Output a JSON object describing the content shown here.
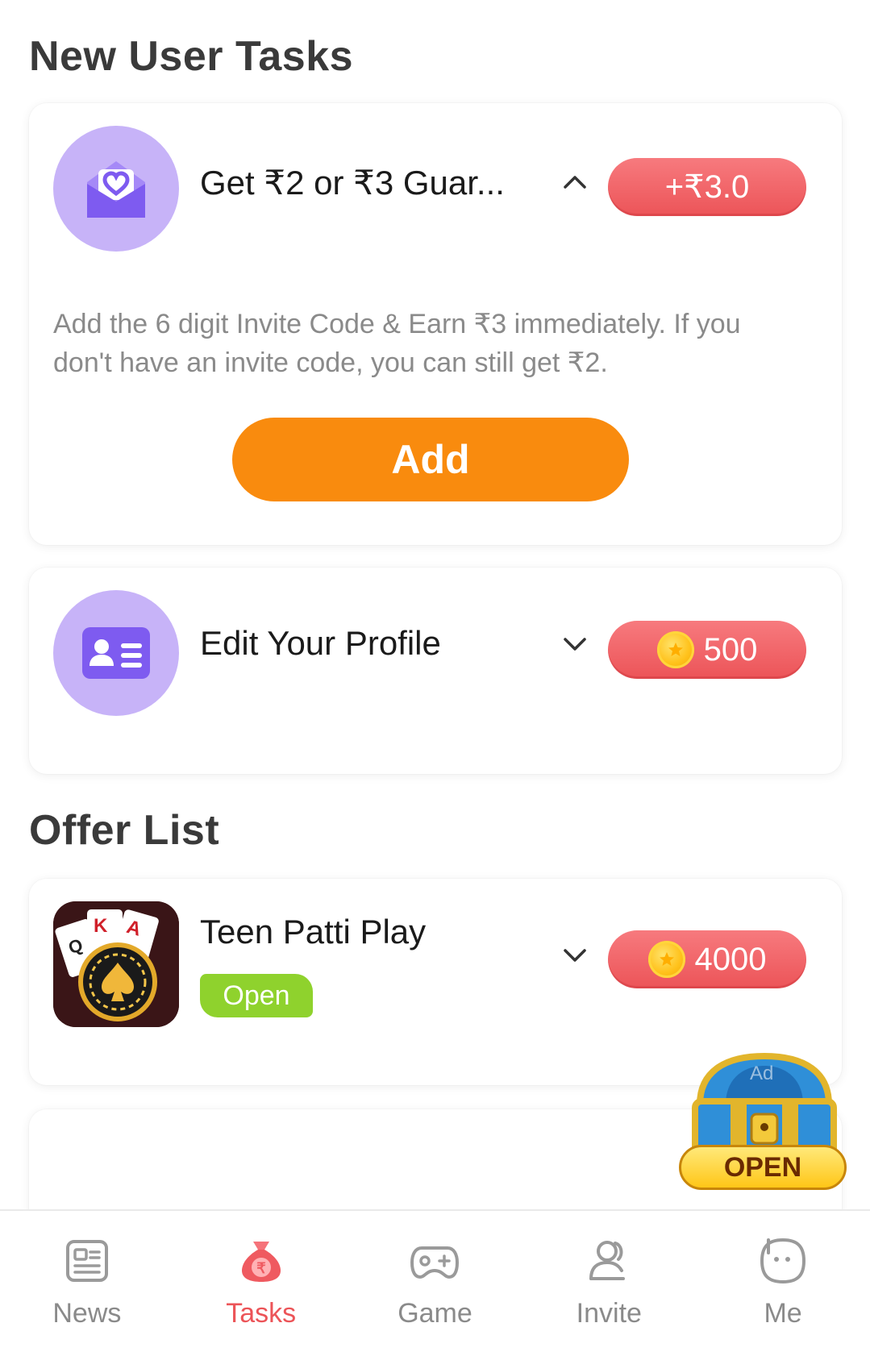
{
  "sections": {
    "new_user_title": "New User Tasks",
    "offer_title": "Offer List"
  },
  "tasks": [
    {
      "title": "Get ₹2 or ₹3 Guar...",
      "reward": "+₹3.0",
      "description": "Add the 6 digit Invite Code & Earn ₹3 immediately. If you don't have an invite code, you can still get ₹2.",
      "button_label": "Add",
      "icon": "envelope-heart-icon",
      "expanded": true
    },
    {
      "title": "Edit Your Profile",
      "reward": "500",
      "icon": "id-card-icon",
      "expanded": false
    }
  ],
  "offers": [
    {
      "title": "Teen Patti Play",
      "status": "Open",
      "reward": "4000",
      "icon": "teen-patti-app-icon"
    }
  ],
  "floating_chest": {
    "label": "OPEN",
    "badge": "Ad"
  },
  "tabs": [
    {
      "label": "News",
      "icon": "news-icon",
      "active": false
    },
    {
      "label": "Tasks",
      "icon": "money-bag-icon",
      "active": true
    },
    {
      "label": "Game",
      "icon": "gamepad-icon",
      "active": false
    },
    {
      "label": "Invite",
      "icon": "invite-people-icon",
      "active": false
    },
    {
      "label": "Me",
      "icon": "face-icon",
      "active": false
    }
  ],
  "colors": {
    "accent_red": "#ec5458",
    "button_orange": "#f98b0e",
    "open_green": "#8fd22d",
    "avatar_purple": "#c7b3f8",
    "icon_purple": "#7e5bf0"
  }
}
